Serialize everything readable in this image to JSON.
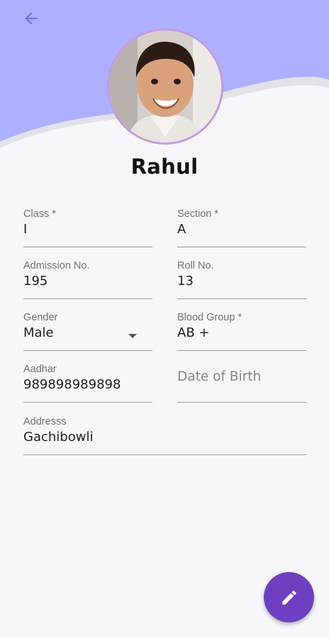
{
  "colors": {
    "header_background": "#afafff",
    "accent": "#6f3fc2",
    "avatar_ring": "#c39be0"
  },
  "icons": {
    "back": "arrow-left",
    "fab": "pencil"
  },
  "student": {
    "name": "Rahul"
  },
  "form": {
    "class": {
      "label": "Class *",
      "value": "I"
    },
    "section": {
      "label": "Section *",
      "value": "A"
    },
    "admission_no": {
      "label": "Admission No.",
      "value": "195"
    },
    "roll_no": {
      "label": "Roll No.",
      "value": "13"
    },
    "gender": {
      "label": "Gender",
      "value": "Male"
    },
    "blood_group": {
      "label": "Blood Group *",
      "value": "AB +"
    },
    "aadhar": {
      "label": "Aadhar",
      "value": "989898989898"
    },
    "date_of_birth": {
      "placeholder": "Date of Birth"
    },
    "address": {
      "label": "Addresss",
      "value": "Gachibowli"
    }
  }
}
